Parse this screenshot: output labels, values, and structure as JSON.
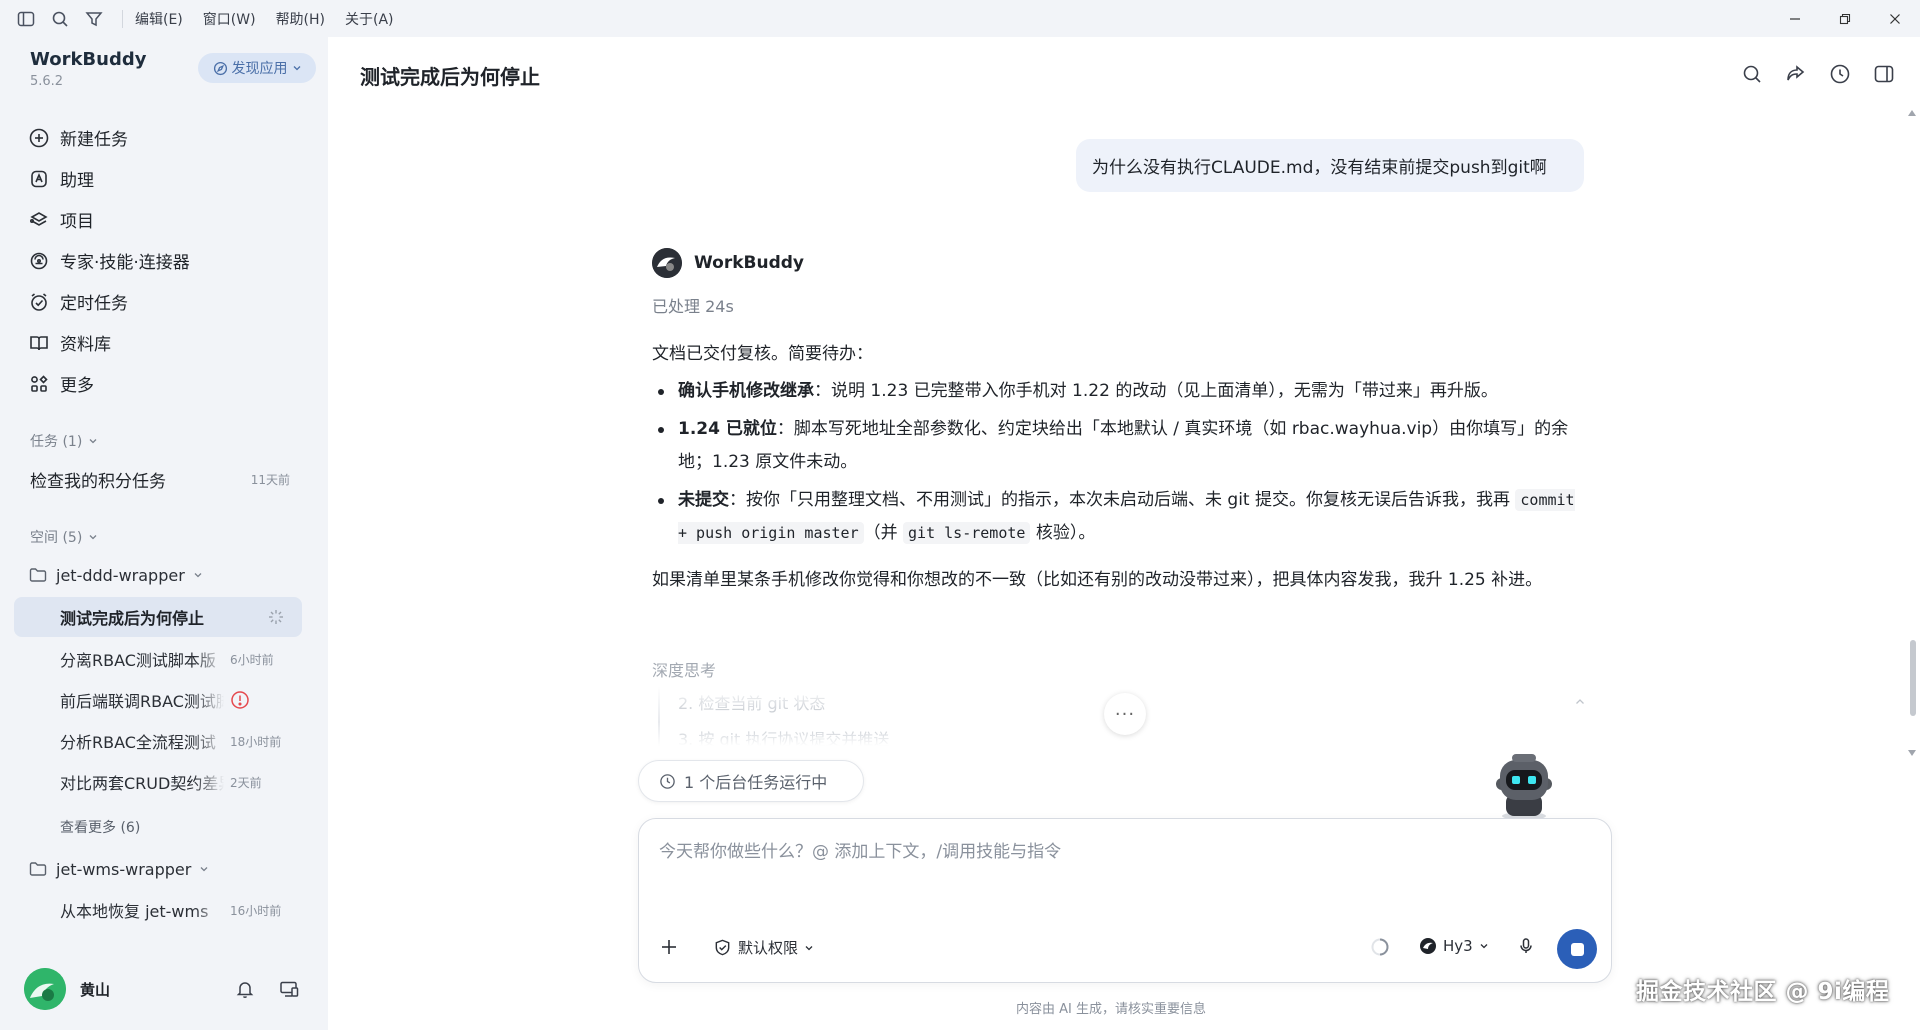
{
  "menubar": {
    "items": [
      "编辑(E)",
      "窗口(W)",
      "帮助(H)",
      "关于(A)"
    ]
  },
  "sidebar": {
    "app_name": "WorkBuddy",
    "version": "5.6.2",
    "discover_label": "发现应用",
    "nav": [
      {
        "label": "新建任务",
        "icon": "plus-circle-icon"
      },
      {
        "label": "助理",
        "icon": "assistant-icon"
      },
      {
        "label": "项目",
        "icon": "project-icon"
      },
      {
        "label": "专家·技能·连接器",
        "icon": "expert-icon"
      },
      {
        "label": "定时任务",
        "icon": "alarm-clock-icon"
      },
      {
        "label": "资料库",
        "icon": "book-icon"
      },
      {
        "label": "更多",
        "icon": "grid-icon"
      }
    ],
    "tasks_section": "任务 (1)",
    "tasks": [
      {
        "title": "检查我的积分任务",
        "time": "11天前"
      }
    ],
    "spaces_section": "空间 (5)",
    "space1": {
      "name": "jet-ddd-wrapper",
      "items": [
        {
          "title": "测试完成后为何停止",
          "time": ""
        },
        {
          "title": "分离RBAC测试脚本版",
          "time": "6小时前"
        },
        {
          "title": "前后端联调RBAC测试脚本",
          "time": ""
        },
        {
          "title": "分析RBAC全流程测试",
          "time": "18小时前"
        },
        {
          "title": "对比两套CRUD契约差异",
          "time": "2天前"
        }
      ],
      "see_more": "查看更多 (6)"
    },
    "space2": {
      "name": "jet-wms-wrapper",
      "items": [
        {
          "title": "从本地恢复 jet-wms",
          "time": "16小时前"
        }
      ]
    },
    "user_name": "黄山"
  },
  "main": {
    "title": "测试完成后为何停止",
    "user_message": "为什么没有执行CLAUDE.md，没有结束前提交push到git啊",
    "bot_name": "WorkBuddy",
    "processed": "已处理 24s",
    "intro": "文档已交付复核。简要待办：",
    "bullets": [
      {
        "head": "确认手机修改继承",
        "body": "：说明 1.23 已完整带入你手机对 1.22 的改动（见上面清单），无需为「带过来」再升版。"
      },
      {
        "head": "1.24 已就位",
        "body": "：脚本写死地址全部参数化、约定块给出「本地默认 / 真实环境（如 rbac.wayhua.vip）由你填写」的余地；1.23 原文件未动。"
      },
      {
        "head": "未提交",
        "body_a": "：按你「只用整理文档、不用测试」的指示，本次未启动后端、未 git 提交。你复核无误后告诉我，我再 ",
        "code1": "commit + push origin master",
        "body_b": "（并 ",
        "code2": "git ls-remote",
        "body_c": " 核验）。"
      }
    ],
    "closing": "如果清单里某条手机修改你觉得和你想改的不一致（比如还有别的改动没带过来），把具体内容发我，我升 1.25 补进。",
    "deep_think_label": "深度思考",
    "think_steps": [
      "2. 检查当前 git 状态",
      "3. 按 git 执行协议提交并推送"
    ],
    "more_dots": "···",
    "bg_task": "1 个后台任务运行中"
  },
  "composer": {
    "placeholder": "今天帮你做些什么？@ 添加上下文，/调用技能与指令",
    "permission": "默认权限",
    "model": "Hy3"
  },
  "footer": {
    "disclaimer": "内容由 AI 生成，请核实重要信息",
    "watermark": "掘金技术社区 @ 9i编程"
  },
  "colors": {
    "accent": "#2b5fb8",
    "sidebar_bg": "#f2f4f8",
    "alert": "#e5484d"
  }
}
